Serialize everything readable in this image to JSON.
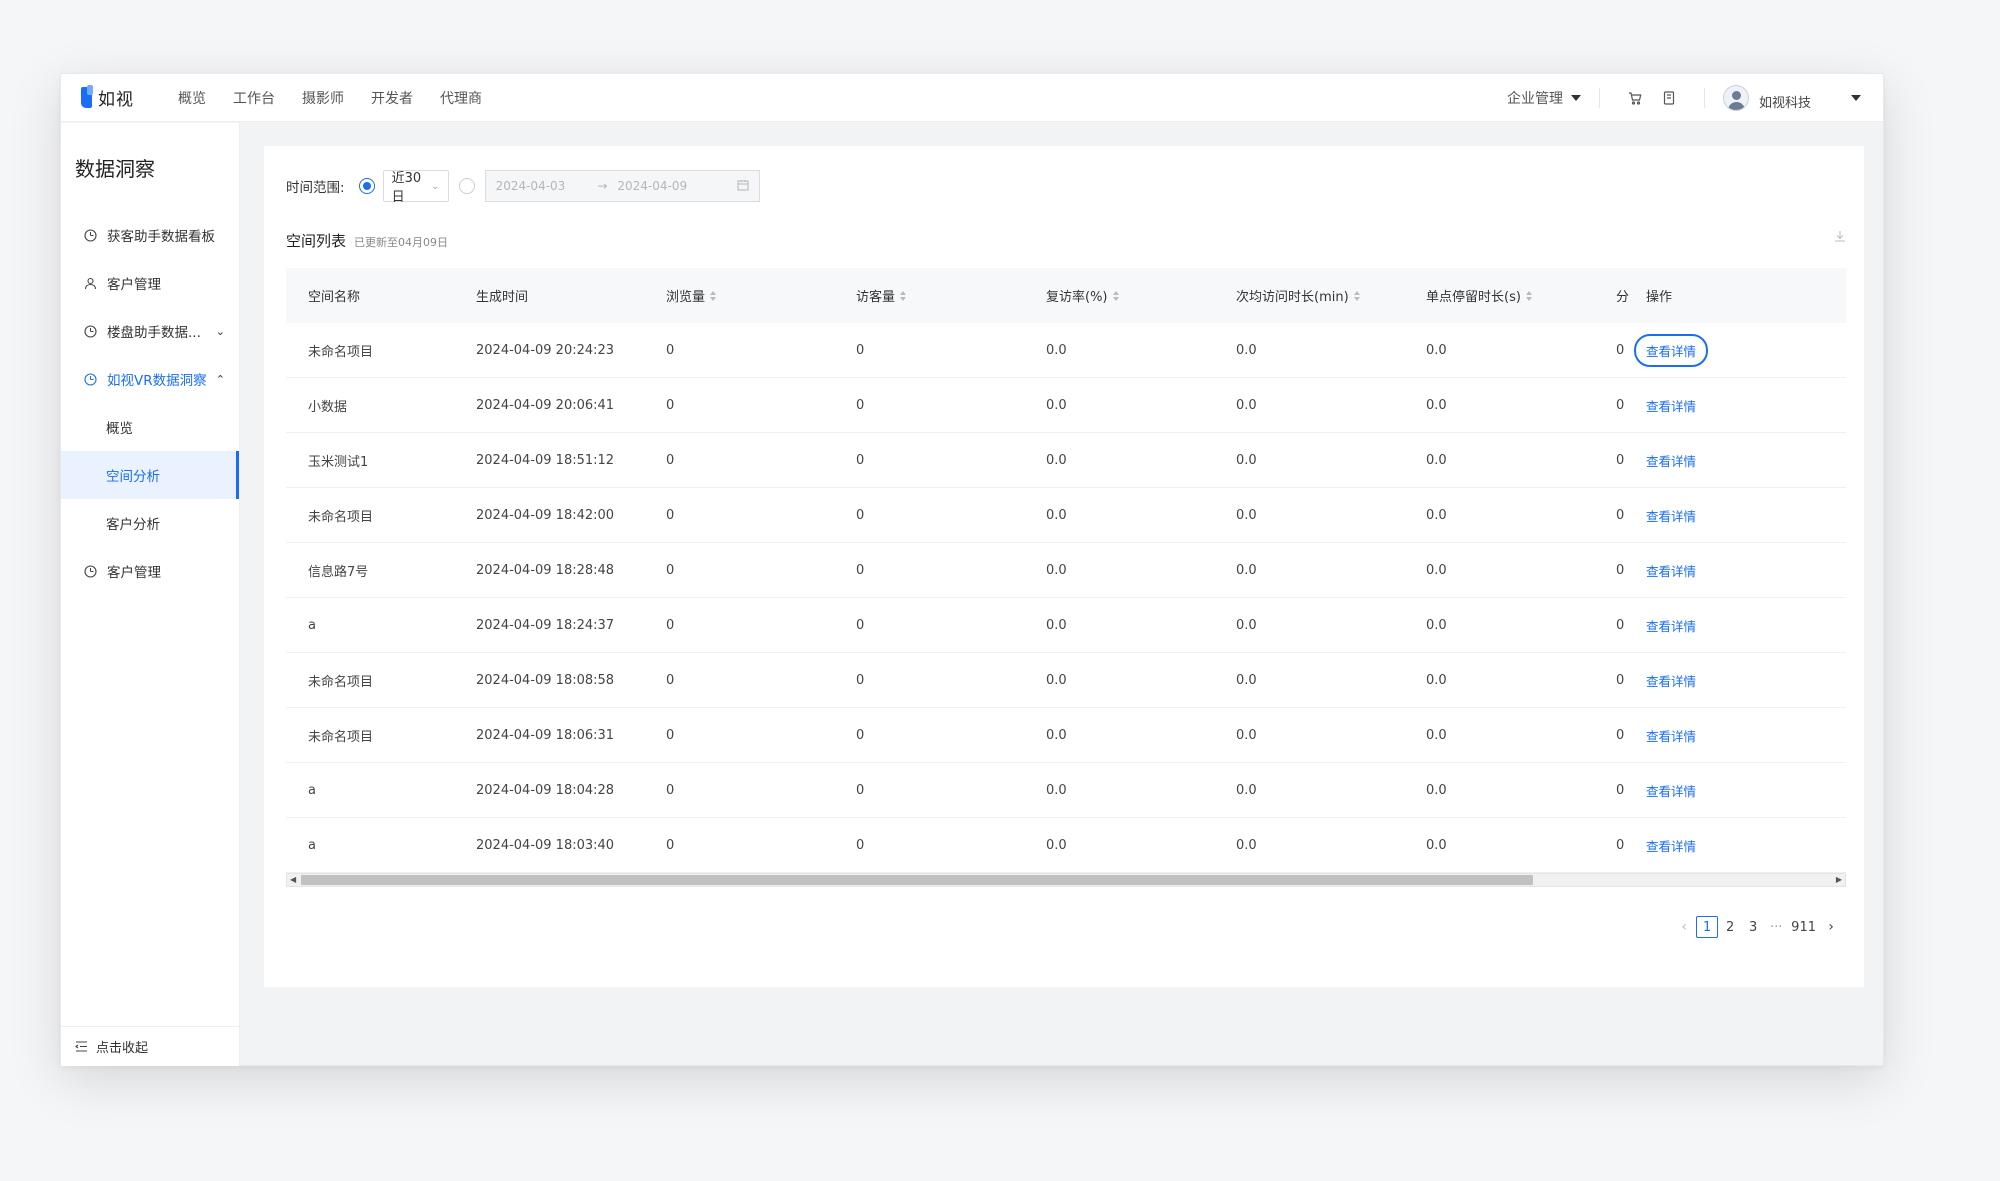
{
  "app": {
    "logo_text": "如视"
  },
  "topnav": [
    "概览",
    "工作台",
    "摄影师",
    "开发者",
    "代理商"
  ],
  "topbar": {
    "enterprise_label": "企业管理",
    "username": "如视科技"
  },
  "sidebar": {
    "title": "数据洞察",
    "items": [
      {
        "label": "获客助手数据看板"
      },
      {
        "label": "客户管理"
      },
      {
        "label": "楼盘助手数据..."
      },
      {
        "label": "如视VR数据洞察"
      },
      {
        "label": "概览"
      },
      {
        "label": "空间分析"
      },
      {
        "label": "客户分析"
      },
      {
        "label": "客户管理"
      }
    ],
    "collapse_label": "点击收起"
  },
  "filter": {
    "label": "时间范围:",
    "preset_value": "近30日",
    "start_placeholder": "2024-04-03",
    "end_placeholder": "2024-04-09"
  },
  "list": {
    "title": "空间列表",
    "updated": "已更新至04月09日"
  },
  "table": {
    "headers": {
      "name": "空间名称",
      "time": "生成时间",
      "pv": "浏览量",
      "uv": "访客量",
      "revisit": "复访率(%)",
      "avg": "次均访问时长(min)",
      "stay": "单点停留时长(s)",
      "extra": "分",
      "op": "操作"
    },
    "rows": [
      {
        "name": "未命名项目",
        "time": "2024-04-09 20:24:23",
        "pv": "0",
        "uv": "0",
        "revisit": "0.0",
        "avg": "0.0",
        "stay": "0.0",
        "extra": "0",
        "op": "查看详情"
      },
      {
        "name": "小数据",
        "time": "2024-04-09 20:06:41",
        "pv": "0",
        "uv": "0",
        "revisit": "0.0",
        "avg": "0.0",
        "stay": "0.0",
        "extra": "0",
        "op": "查看详情"
      },
      {
        "name": "玉米测试1",
        "time": "2024-04-09 18:51:12",
        "pv": "0",
        "uv": "0",
        "revisit": "0.0",
        "avg": "0.0",
        "stay": "0.0",
        "extra": "0",
        "op": "查看详情"
      },
      {
        "name": "未命名项目",
        "time": "2024-04-09 18:42:00",
        "pv": "0",
        "uv": "0",
        "revisit": "0.0",
        "avg": "0.0",
        "stay": "0.0",
        "extra": "0",
        "op": "查看详情"
      },
      {
        "name": "信息路7号",
        "time": "2024-04-09 18:28:48",
        "pv": "0",
        "uv": "0",
        "revisit": "0.0",
        "avg": "0.0",
        "stay": "0.0",
        "extra": "0",
        "op": "查看详情"
      },
      {
        "name": "a",
        "time": "2024-04-09 18:24:37",
        "pv": "0",
        "uv": "0",
        "revisit": "0.0",
        "avg": "0.0",
        "stay": "0.0",
        "extra": "0",
        "op": "查看详情"
      },
      {
        "name": "未命名项目",
        "time": "2024-04-09 18:08:58",
        "pv": "0",
        "uv": "0",
        "revisit": "0.0",
        "avg": "0.0",
        "stay": "0.0",
        "extra": "0",
        "op": "查看详情"
      },
      {
        "name": "未命名项目",
        "time": "2024-04-09 18:06:31",
        "pv": "0",
        "uv": "0",
        "revisit": "0.0",
        "avg": "0.0",
        "stay": "0.0",
        "extra": "0",
        "op": "查看详情"
      },
      {
        "name": "a",
        "time": "2024-04-09 18:04:28",
        "pv": "0",
        "uv": "0",
        "revisit": "0.0",
        "avg": "0.0",
        "stay": "0.0",
        "extra": "0",
        "op": "查看详情"
      },
      {
        "name": "a",
        "time": "2024-04-09 18:03:40",
        "pv": "0",
        "uv": "0",
        "revisit": "0.0",
        "avg": "0.0",
        "stay": "0.0",
        "extra": "0",
        "op": "查看详情"
      }
    ]
  },
  "pagination": {
    "pages": [
      "1",
      "2",
      "3"
    ],
    "ellipsis": "···",
    "last": "911",
    "current": "1"
  },
  "icons": {
    "logo": "logo-icon",
    "cart": "cart-icon",
    "doc": "document-icon",
    "sidebar": [
      "dashboard-icon",
      "user-group-icon",
      "dashboard-icon",
      "dashboard-icon",
      "dashboard-icon"
    ],
    "collapse": "menu-collapse-icon",
    "download": "download-icon",
    "calendar": "calendar-icon"
  },
  "colors": {
    "accent": "#1a6df5"
  }
}
